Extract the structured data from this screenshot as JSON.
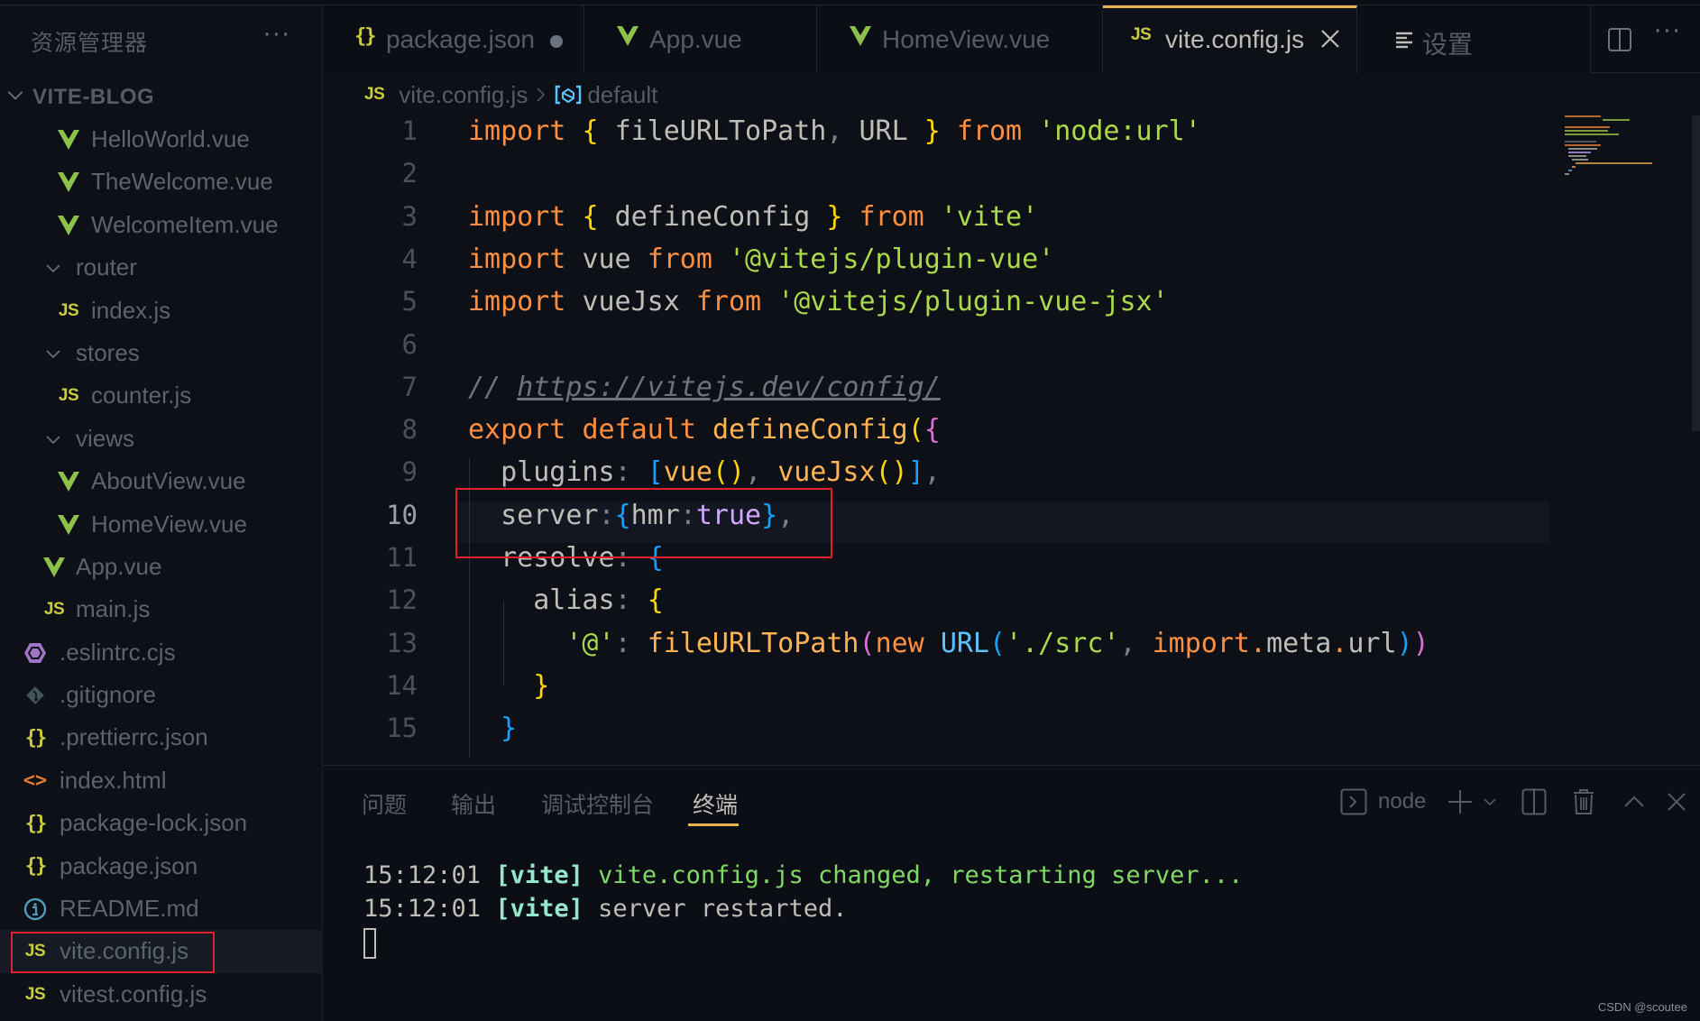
{
  "sidebar": {
    "title": "资源管理器",
    "more_icon": "ellipsis-icon",
    "project_name": "VITE-BLOG",
    "items": [
      {
        "label": "HelloWorld.vue",
        "icon": "vue-icon",
        "type": "file",
        "indent": 3
      },
      {
        "label": "TheWelcome.vue",
        "icon": "vue-icon",
        "type": "file",
        "indent": 3
      },
      {
        "label": "WelcomeItem.vue",
        "icon": "vue-icon",
        "type": "file",
        "indent": 3
      },
      {
        "label": "router",
        "icon": "chevron-down-icon",
        "type": "folder",
        "indent": 2
      },
      {
        "label": "index.js",
        "icon": "js-icon",
        "type": "file",
        "indent": 3
      },
      {
        "label": "stores",
        "icon": "chevron-down-icon",
        "type": "folder",
        "indent": 2
      },
      {
        "label": "counter.js",
        "icon": "js-icon",
        "type": "file",
        "indent": 3
      },
      {
        "label": "views",
        "icon": "chevron-down-icon",
        "type": "folder",
        "indent": 2
      },
      {
        "label": "AboutView.vue",
        "icon": "vue-icon",
        "type": "file",
        "indent": 3
      },
      {
        "label": "HomeView.vue",
        "icon": "vue-icon",
        "type": "file",
        "indent": 3
      },
      {
        "label": "App.vue",
        "icon": "vue-icon",
        "type": "file",
        "indent": 2
      },
      {
        "label": "main.js",
        "icon": "js-icon",
        "type": "file",
        "indent": 2
      },
      {
        "label": ".eslintrc.cjs",
        "icon": "eslint-icon",
        "type": "file",
        "indent": 1
      },
      {
        "label": ".gitignore",
        "icon": "git-icon",
        "type": "file",
        "indent": 1
      },
      {
        "label": ".prettierrc.json",
        "icon": "json-icon",
        "type": "file",
        "indent": 1
      },
      {
        "label": "index.html",
        "icon": "html-icon",
        "type": "file",
        "indent": 1
      },
      {
        "label": "package-lock.json",
        "icon": "json-icon",
        "type": "file",
        "indent": 1
      },
      {
        "label": "package.json",
        "icon": "json-icon",
        "type": "file",
        "indent": 1
      },
      {
        "label": "README.md",
        "icon": "info-icon",
        "type": "file",
        "indent": 1
      },
      {
        "label": "vite.config.js",
        "icon": "js-icon",
        "type": "file",
        "indent": 1,
        "selected": true,
        "highlighted": true
      },
      {
        "label": "vitest.config.js",
        "icon": "js-icon",
        "type": "file",
        "indent": 1
      }
    ]
  },
  "tabs": [
    {
      "label": "package.json",
      "icon": "json-icon",
      "modified": true
    },
    {
      "label": "App.vue",
      "icon": "vue-icon"
    },
    {
      "label": "HomeView.vue",
      "icon": "vue-icon"
    },
    {
      "label": "vite.config.js",
      "icon": "js-icon",
      "active": true
    },
    {
      "label": "设置",
      "icon": "settings-list-icon"
    }
  ],
  "tab_actions": [
    "split-editor-icon",
    "ellipsis-icon"
  ],
  "breadcrumb": {
    "file": "vite.config.js",
    "symbol": "default"
  },
  "editor": {
    "current_line": 10,
    "lines": [
      {
        "n": "1",
        "text": "import { fileURLToPath, URL } from 'node:url'"
      },
      {
        "n": "2",
        "text": ""
      },
      {
        "n": "3",
        "text": "import { defineConfig } from 'vite'"
      },
      {
        "n": "4",
        "text": "import vue from '@vitejs/plugin-vue'"
      },
      {
        "n": "5",
        "text": "import vueJsx from '@vitejs/plugin-vue-jsx'"
      },
      {
        "n": "6",
        "text": ""
      },
      {
        "n": "7",
        "text": "// https://vitejs.dev/config/"
      },
      {
        "n": "8",
        "text": "export default defineConfig({"
      },
      {
        "n": "9",
        "text": "  plugins: [vue(), vueJsx()],"
      },
      {
        "n": "10",
        "text": "  server:{hmr:true},"
      },
      {
        "n": "11",
        "text": "  resolve: {"
      },
      {
        "n": "12",
        "text": "    alias: {"
      },
      {
        "n": "13",
        "text": "      '@': fileURLToPath(new URL('./src', import.meta.url))"
      },
      {
        "n": "14",
        "text": "    }"
      },
      {
        "n": "15",
        "text": "  }"
      }
    ],
    "tokens": {
      "import": "import",
      "from": "from",
      "export": "export",
      "default": "default",
      "new": "new",
      "true": "true",
      "fileURLToPath": "fileURLToPath",
      "URL": "URL",
      "defineConfig": "defineConfig",
      "vue": "vue",
      "vueJsx": "vueJsx",
      "node_url": "'node:url'",
      "vite": "'vite'",
      "plugin_vue": "'@vitejs/plugin-vue'",
      "plugin_vue_jsx": "'@vitejs/plugin-vue-jsx'",
      "comment_prefix": "// ",
      "comment_url": "https://vitejs.dev/config/",
      "plugins": "plugins",
      "server": "server",
      "hmr": "hmr",
      "resolve": "resolve",
      "alias": "alias",
      "at": "'@'",
      "src": "'./src'",
      "meta": "meta",
      "url": "url"
    }
  },
  "panel": {
    "tabs": [
      {
        "label": "问题"
      },
      {
        "label": "输出"
      },
      {
        "label": "调试控制台"
      },
      {
        "label": "终端",
        "active": true
      }
    ],
    "terminal_name": "node",
    "actions": [
      "terminal-icon",
      "add-icon",
      "chevron-down-icon",
      "split-terminal-icon",
      "trash-icon",
      "maximize-panel-icon",
      "close-icon"
    ],
    "terminal_lines": [
      {
        "time": "15:12:01",
        "tag": "[vite]",
        "msg": "vite.config.js changed, restarting server...",
        "kind": "ok"
      },
      {
        "time": "15:12:01",
        "tag": "[vite]",
        "msg": "server restarted.",
        "kind": "plain"
      }
    ]
  },
  "watermark": "CSDN @scoutee",
  "colors": {
    "accent": "#e6b450",
    "keyword": "#ff8f40",
    "string": "#aad94c",
    "function": "#ffb454",
    "class": "#59c2ff",
    "boolean": "#d2a6ff",
    "highlight_box": "#e0202a",
    "vue_green": "#8dc149",
    "js_yellow": "#cbcb41"
  }
}
